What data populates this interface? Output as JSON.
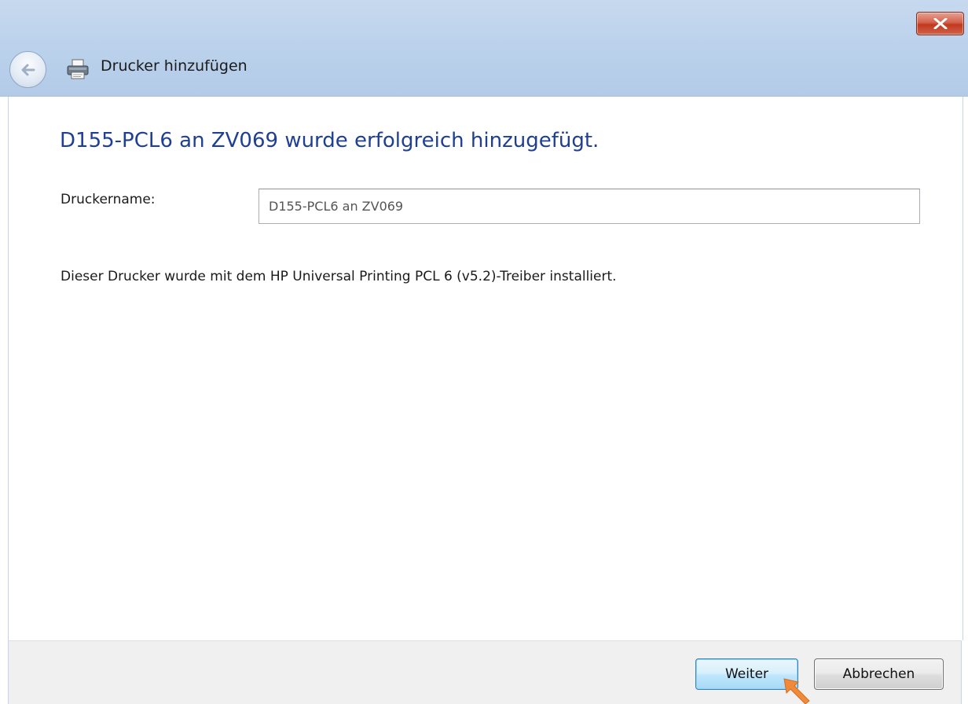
{
  "window": {
    "title": "Drucker hinzufügen"
  },
  "main": {
    "heading": "D155-PCL6 an ZV069 wurde erfolgreich hinzugefügt.",
    "printer_name_label": "Druckername:",
    "printer_name_value": "D155-PCL6 an ZV069",
    "info_text": "Dieser Drucker wurde mit dem HP Universal Printing PCL 6 (v5.2)-Treiber installiert."
  },
  "footer": {
    "next_label": "Weiter",
    "cancel_label": "Abbrechen"
  },
  "icons": {
    "close": "close-icon",
    "back": "back-arrow-icon",
    "printer": "printer-icon",
    "cursor": "cursor-arrow-icon"
  },
  "colors": {
    "heading": "#1e3f93",
    "close_button": "#c2391f",
    "cursor": "#f0893a"
  }
}
